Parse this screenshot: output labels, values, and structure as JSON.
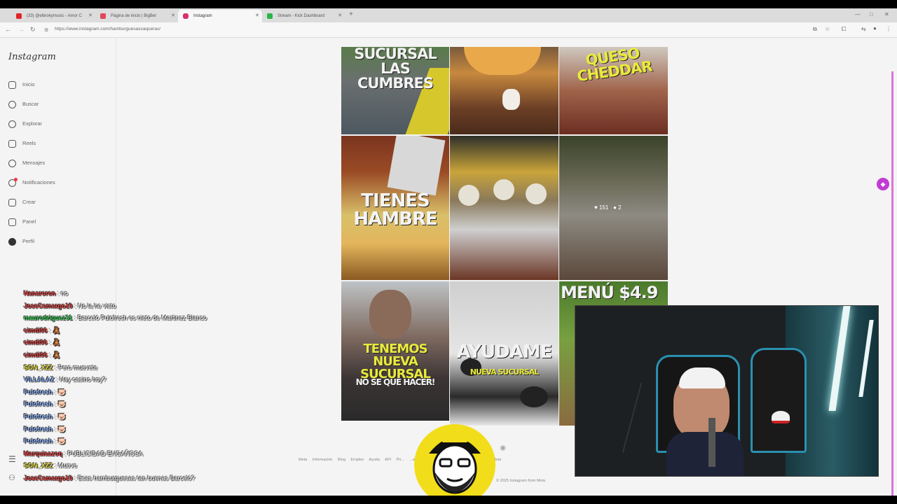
{
  "browser": {
    "tabs": [
      {
        "title": "(33) @elbrokymusic - Amor C",
        "color": "#e02525"
      },
      {
        "title": "Página de inicio | BigBet",
        "color": "#e0485a"
      },
      {
        "title": "Instagram",
        "color": "#d6306f"
      },
      {
        "title": "Stream - Kick Dashboard",
        "color": "#2bb34a"
      }
    ],
    "url": "https://www.instagram.com/hamburguesasvaqueras/"
  },
  "instagram": {
    "logo": "Instagram",
    "nav": [
      {
        "label": "Inicio",
        "icon": "home-icon"
      },
      {
        "label": "Buscar",
        "icon": "search-icon"
      },
      {
        "label": "Explorar",
        "icon": "compass-icon"
      },
      {
        "label": "Reels",
        "icon": "reels-icon"
      },
      {
        "label": "Mensajes",
        "icon": "messenger-icon"
      },
      {
        "label": "Notificaciones",
        "icon": "heart-icon"
      },
      {
        "label": "Crear",
        "icon": "plus-icon"
      },
      {
        "label": "Panel",
        "icon": "dashboard-icon"
      },
      {
        "label": "Perfil",
        "icon": "avatar-icon"
      }
    ],
    "posts": [
      {
        "text": "SUCURSAL LAS CUMBRES"
      },
      {
        "text": ""
      },
      {
        "text": "QUESO CHEDDAR"
      },
      {
        "text": "TIENES HAMBRE"
      },
      {
        "text": ""
      },
      {
        "text": ""
      },
      {
        "text": "TENEMOS NUEVA SUCURSAL",
        "sub": "NO SE QUÉ HACER!"
      },
      {
        "text": "AYUDAME",
        "sub": "NUEVA SUCURSAL"
      },
      {
        "text": "MENÚ $4.9"
      }
    ],
    "hover_likes": "151",
    "hover_comments": "2",
    "footer_links": "Meta Información Blog Empleo Ayuda API Pri... ...agram Lite Meta AI Artículos de Meta",
    "copyright": "© 2025 Instagram from Meta"
  },
  "chat": [
    {
      "user": "Nanaroron",
      "text": ": no",
      "color": "#e14141"
    },
    {
      "user": "JoseCamargo19",
      "text": ": No la he visto",
      "color": "#e14141"
    },
    {
      "user": "maurodriguez31",
      "text": ": Barceló Fulofresh es nieto de Martinez Blanco",
      "color": "#3fcf5c"
    },
    {
      "user": "cimdi06",
      "text": ": 🧸",
      "color": "#e14141"
    },
    {
      "user": "cimdi06",
      "text": ": 🧸",
      "color": "#e14141"
    },
    {
      "user": "cimdi06",
      "text": ": 🧸",
      "color": "#e14141"
    },
    {
      "user": "SON_XZZ",
      "text": ": Pero muevete",
      "color": "#e8e23a"
    },
    {
      "user": "VILLALAZ",
      "text": ": Hay casino hoy?",
      "color": "#8fb4ff"
    },
    {
      "user": "Fulofresh",
      "text": ": 🐷",
      "color": "#8fb4ff"
    },
    {
      "user": "Fulofresh",
      "text": ": 🐷",
      "color": "#8fb4ff"
    },
    {
      "user": "Fulofresh",
      "text": ": 🐷",
      "color": "#8fb4ff"
    },
    {
      "user": "Fulofresh",
      "text": ": 🐷",
      "color": "#8fb4ff"
    },
    {
      "user": "Fulofresh",
      "text": ": 🐷",
      "color": "#8fb4ff"
    },
    {
      "user": "Marquiaazoq",
      "text": ": PUBLICIDAD ENGAÑOSA",
      "color": "#e14141"
    },
    {
      "user": "SON_XZZ",
      "text": ": Mueve",
      "color": "#e8e23a"
    },
    {
      "user": "JoseCamargo19",
      "text": ": Esas hamburguesas tan buenas Barceló?",
      "color": "#e14141"
    }
  ]
}
